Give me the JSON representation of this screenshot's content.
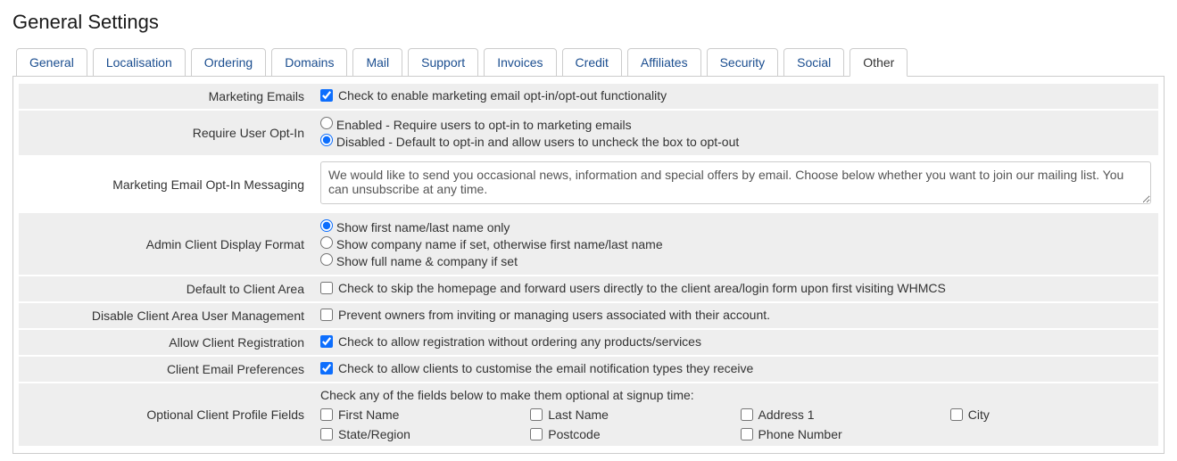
{
  "pageTitle": "General Settings",
  "tabs": [
    {
      "label": "General"
    },
    {
      "label": "Localisation"
    },
    {
      "label": "Ordering"
    },
    {
      "label": "Domains"
    },
    {
      "label": "Mail"
    },
    {
      "label": "Support"
    },
    {
      "label": "Invoices"
    },
    {
      "label": "Credit"
    },
    {
      "label": "Affiliates"
    },
    {
      "label": "Security"
    },
    {
      "label": "Social"
    },
    {
      "label": "Other"
    }
  ],
  "rows": {
    "marketingEmails": {
      "label": "Marketing Emails",
      "text": "Check to enable marketing email opt-in/opt-out functionality"
    },
    "requireOptIn": {
      "label": "Require User Opt-In",
      "enabled": "Enabled - Require users to opt-in to marketing emails",
      "disabled": "Disabled - Default to opt-in and allow users to uncheck the box to opt-out"
    },
    "optInMessaging": {
      "label": "Marketing Email Opt-In Messaging",
      "value": "We would like to send you occasional news, information and special offers by email. Choose below whether you want to join our mailing list. You can unsubscribe at any time."
    },
    "adminClientDisplay": {
      "label": "Admin Client Display Format",
      "opt1": "Show first name/last name only",
      "opt2": "Show company name if set, otherwise first name/last name",
      "opt3": "Show full name & company if set"
    },
    "defaultClientArea": {
      "label": "Default to Client Area",
      "text": "Check to skip the homepage and forward users directly to the client area/login form upon first visiting WHMCS"
    },
    "disableUserMgmt": {
      "label": "Disable Client Area User Management",
      "text": "Prevent owners from inviting or managing users associated with their account."
    },
    "allowReg": {
      "label": "Allow Client Registration",
      "text": "Check to allow registration without ordering any products/services"
    },
    "emailPrefs": {
      "label": "Client Email Preferences",
      "text": "Check to allow clients to customise the email notification types they receive"
    },
    "optionalFields": {
      "label": "Optional Client Profile Fields",
      "intro": "Check any of the fields below to make them optional at signup time:",
      "fields": {
        "firstName": "First Name",
        "lastName": "Last Name",
        "address1": "Address 1",
        "city": "City",
        "state": "State/Region",
        "postcode": "Postcode",
        "phone": "Phone Number"
      }
    }
  }
}
